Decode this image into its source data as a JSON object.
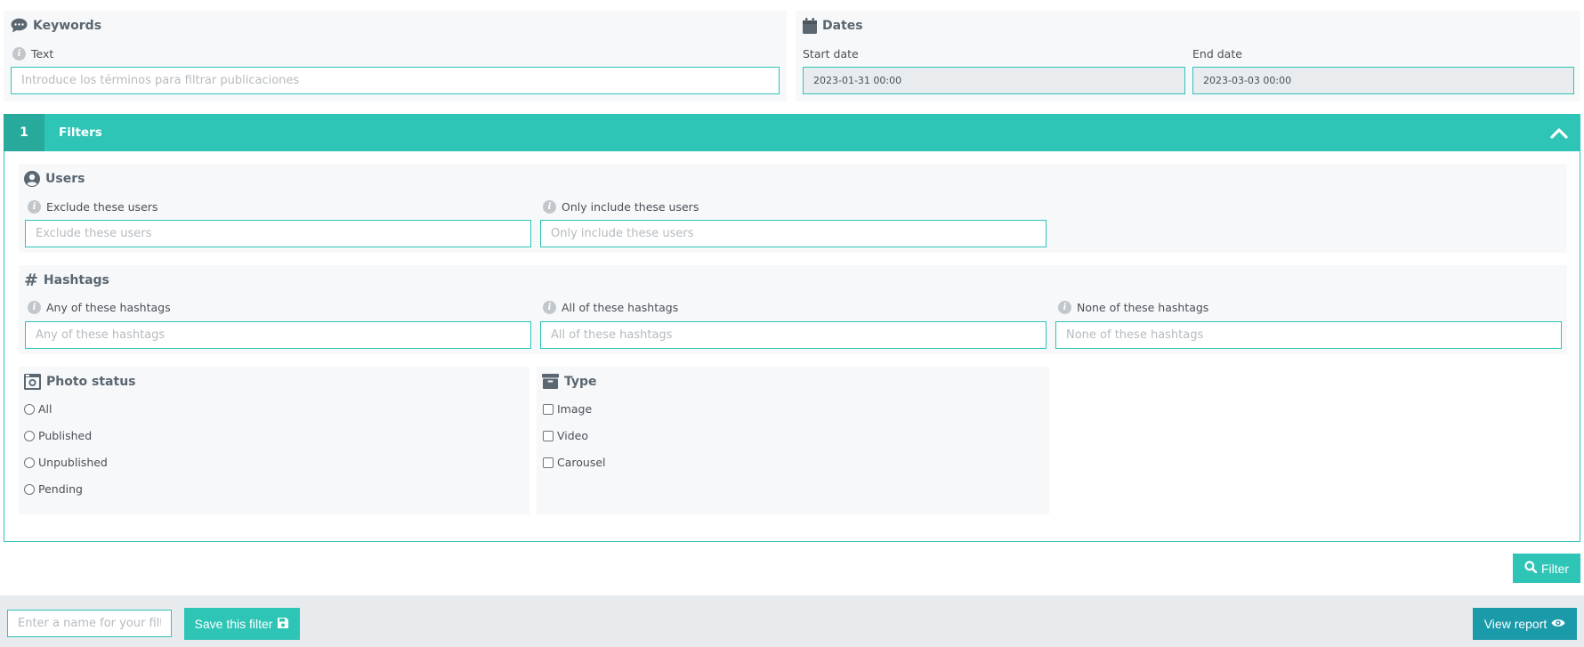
{
  "keywords": {
    "title": "Keywords",
    "icon": "comment-icon",
    "text_label": "Text",
    "text_placeholder": "Introduce los términos para filtrar publicaciones"
  },
  "dates": {
    "title": "Dates",
    "icon": "calendar-icon",
    "start_label": "Start date",
    "start_value": "2023-01-31 00:00",
    "end_label": "End date",
    "end_value": "2023-03-03 00:00"
  },
  "filters": {
    "number": "1",
    "title": "Filters",
    "toggle_icon": "chevron-up-icon",
    "users": {
      "title": "Users",
      "icon": "user-circle-icon",
      "exclude_label": "Exclude these users",
      "exclude_placeholder": "Exclude these users",
      "include_label": "Only include these users",
      "include_placeholder": "Only include these users"
    },
    "hashtags": {
      "title": "Hashtags",
      "icon": "hashtag-icon",
      "any_label": "Any of these hashtags",
      "any_placeholder": "Any of these hashtags",
      "all_label": "All of these hashtags",
      "all_placeholder": "All of these hashtags",
      "none_label": "None of these hashtags",
      "none_placeholder": "None of these hashtags"
    },
    "photo_status": {
      "title": "Photo status",
      "icon": "camera-icon",
      "options": [
        "All",
        "Published",
        "Unpublished",
        "Pending"
      ]
    },
    "type": {
      "title": "Type",
      "icon": "archive-icon",
      "options": [
        "Image",
        "Video",
        "Carousel"
      ]
    }
  },
  "actions": {
    "filter_label": "Filter",
    "filter_icon": "search-icon"
  },
  "footer": {
    "name_placeholder": "Enter a name for your filter",
    "save_label": "Save this filter",
    "save_icon": "floppy-disk-icon",
    "view_label": "View report",
    "view_icon": "eye-icon"
  },
  "colors": {
    "accent": "#2ec4b6",
    "accent_dark": "#27a99c",
    "button_dark": "#1b9aaa",
    "panel_bg": "#f7f8fa",
    "footer_bg": "#e8ebee"
  }
}
